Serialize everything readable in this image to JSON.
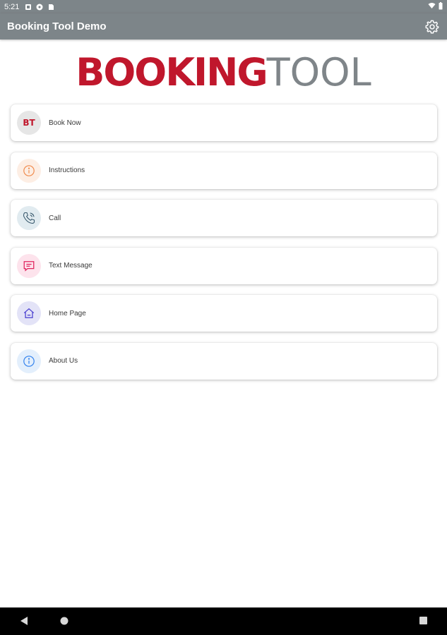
{
  "status_bar": {
    "time": "5:21",
    "icons": [
      "notification-icon",
      "app-icon",
      "sd-card-icon"
    ],
    "right_icons": [
      "wifi-icon",
      "battery-icon"
    ]
  },
  "app_bar": {
    "title": "Booking Tool Demo",
    "settings_icon": "gear-icon"
  },
  "logo": {
    "part1": "BOOKING",
    "part2": "TOOL",
    "colors": {
      "red": "#c0172c",
      "grey": "#7f8589"
    }
  },
  "menu": {
    "items": [
      {
        "label": "Book Now",
        "icon": "bt-logo-icon",
        "icon_text": "BT",
        "bg": "#e6e6e6",
        "color": "#c0172c"
      },
      {
        "label": "Instructions",
        "icon": "info-icon",
        "bg": "#fdeee4",
        "color": "#f08a4b"
      },
      {
        "label": "Call",
        "icon": "phone-icon",
        "bg": "#e1ebf0",
        "color": "#3a5a6e"
      },
      {
        "label": "Text Message",
        "icon": "message-icon",
        "bg": "#fde3ec",
        "color": "#e0245e"
      },
      {
        "label": "Home Page",
        "icon": "home-icon",
        "bg": "#e3e3f7",
        "color": "#4a3fd0"
      },
      {
        "label": "About Us",
        "icon": "info-icon",
        "bg": "#e3effc",
        "color": "#2f80ed"
      }
    ]
  },
  "nav_bar": {
    "buttons": [
      "back-icon",
      "home-icon",
      "recents-icon"
    ]
  }
}
